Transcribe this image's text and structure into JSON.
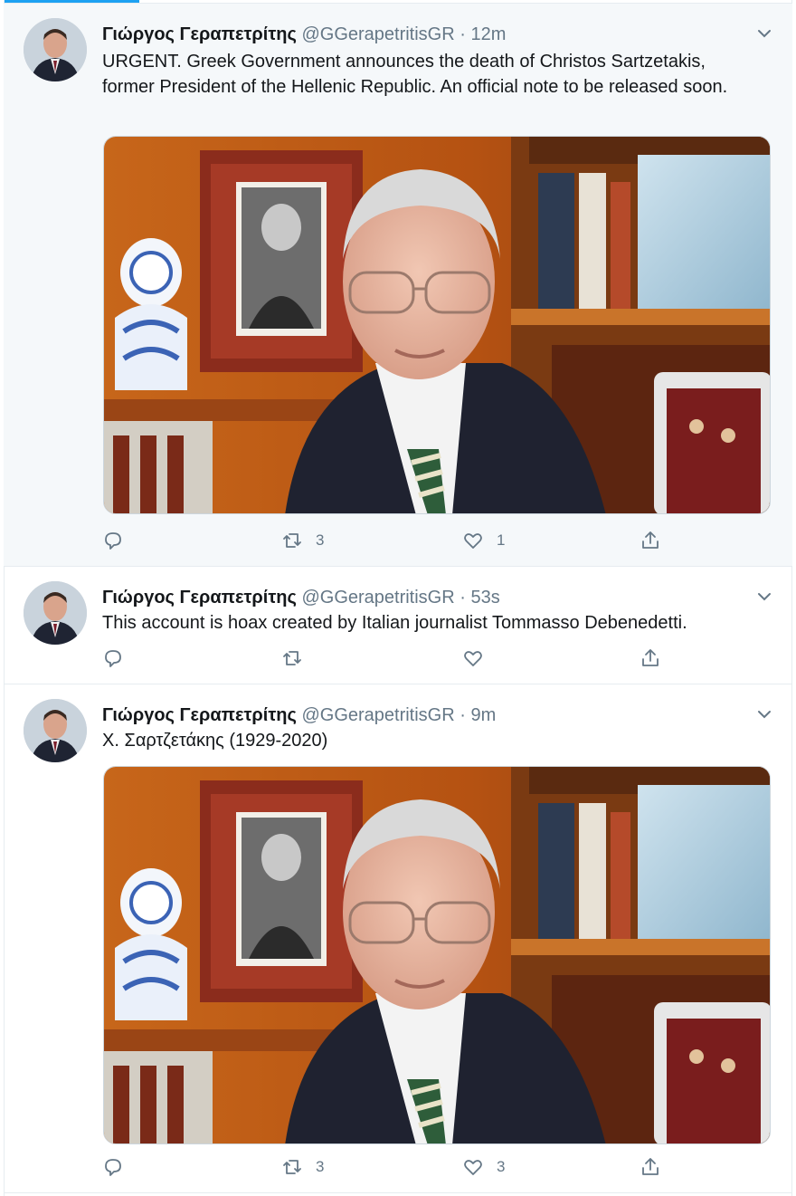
{
  "tweets": [
    {
      "name": "Γιώργος Γεραπετρίτης",
      "handle": "@GGerapetritisGR",
      "separator": "·",
      "time": "12m",
      "text": "URGENT. Greek Government announces the death of Christos Sartzetakis, former President of the Hellenic Republic. An official note to be released soon.",
      "has_media": true,
      "replies": "",
      "retweets": "3",
      "likes": "1"
    },
    {
      "name": "Γιώργος Γεραπετρίτης",
      "handle": "@GGerapetritisGR",
      "separator": "·",
      "time": "53s",
      "text": "This account is hoax created by Italian journalist Tommasso Debenedetti.",
      "has_media": false,
      "replies": "",
      "retweets": "",
      "likes": ""
    },
    {
      "name": "Γιώργος Γεραπετρίτης",
      "handle": "@GGerapetritisGR",
      "separator": "·",
      "time": "9m",
      "text": "Χ. Σαρτζετάκης (1929-2020)",
      "has_media": true,
      "replies": "",
      "retweets": "3",
      "likes": "3"
    }
  ],
  "icons": {
    "reply": "reply-icon",
    "retweet": "retweet-icon",
    "like": "heart-icon",
    "share": "share-icon",
    "more": "chevron-down-icon"
  },
  "colors": {
    "accent": "#1da1f2",
    "secondary_text": "#657786",
    "highlight_bg": "#f5f8fa"
  }
}
